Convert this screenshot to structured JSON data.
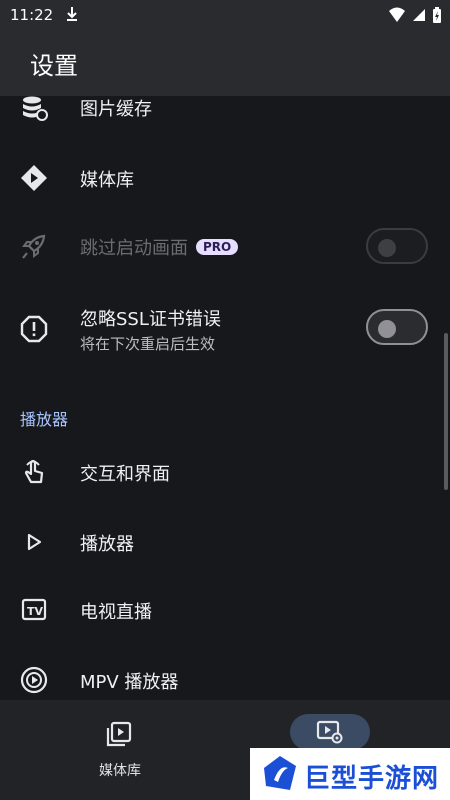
{
  "status_bar": {
    "time": "11:22"
  },
  "app_bar": {
    "title": "设置"
  },
  "items": {
    "image_cache": {
      "label": "图片缓存",
      "icon": "database-icon"
    },
    "media_library": {
      "label": "媒体库",
      "icon": "media-library-icon"
    },
    "skip_splash": {
      "label": "跳过启动画面",
      "badge": "PRO",
      "icon": "rocket-icon",
      "toggle_on": false,
      "enabled": false
    },
    "ignore_ssl": {
      "label": "忽略SSL证书错误",
      "sublabel": "将在下次重启后生效",
      "icon": "alert-circle-icon",
      "toggle_on": false,
      "enabled": true
    }
  },
  "section_player": {
    "title": "播放器"
  },
  "player_items": {
    "interaction_ui": {
      "label": "交互和界面",
      "icon": "touch-icon"
    },
    "player": {
      "label": "播放器",
      "icon": "play-outline-icon"
    },
    "live_tv": {
      "label": "电视直播",
      "icon": "tv-icon"
    },
    "mpv_player": {
      "label": "MPV 播放器",
      "icon": "disc-icon"
    }
  },
  "bottom_nav": {
    "library": {
      "label": "媒体库",
      "icon": "library-icon"
    },
    "settings": {
      "label": "",
      "icon": "video-settings-icon",
      "selected": true
    }
  },
  "watermark": {
    "text": "巨型手游网"
  },
  "colors": {
    "background": "#17181b",
    "app_bar": "#2a2b2e",
    "accent_section": "#a9c5ff",
    "pro_badge_bg": "#e7ddff",
    "watermark_blue": "#1b4fd6"
  }
}
